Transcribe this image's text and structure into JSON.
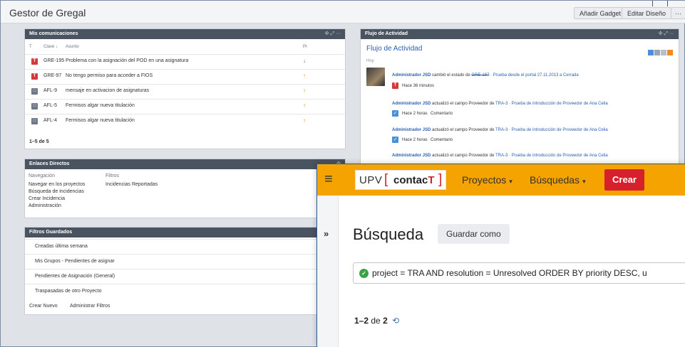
{
  "dashboard": {
    "title": "Gestor de Gregal",
    "add_gadget": "Añadir Gadget",
    "edit_layout": "Editar Diseño",
    "more": "···"
  },
  "comms_gadget": {
    "title": "Mis comunicaciones",
    "controls": "✣ ⤢ ···",
    "col_t": "T",
    "col_key": "Clave ↓",
    "col_summary": "Asunto",
    "col_priority": "Pr",
    "rows": [
      {
        "type": "T",
        "key": "GRE-195",
        "summary": "Problema con la asignación del POD en una asignatura",
        "priority": "↓"
      },
      {
        "type": "T",
        "key": "GRE-97",
        "summary": "No tengo permiso para acceder a FIOS",
        "priority": "↑"
      },
      {
        "type": "□",
        "key": "AFL-9",
        "summary": "mensaje en activacion de asignaturas",
        "priority": "↑"
      },
      {
        "type": "□",
        "key": "AFL-5",
        "summary": "Fermisos algar nueva titulación",
        "priority": "↑"
      },
      {
        "type": "□",
        "key": "AFL-4",
        "summary": "Fermisos algar nueva titulación",
        "priority": "↑"
      }
    ],
    "pager": "1–5 de 5"
  },
  "links_gadget": {
    "title": "Enlaces Directos",
    "controls": "✣",
    "nav_header": "Navegación",
    "filters_header": "Filtros",
    "nav_items": [
      "Navegar en los proyectos",
      "Búsqueda de incidencias",
      "Crear Incidencia",
      "Administración"
    ],
    "filter_items": [
      "Incidencias Reportadas"
    ]
  },
  "saved_filters_gadget": {
    "title": "Filtros Guardados",
    "items": [
      "Creadas última semana",
      "Mis Grupos - Pendientes de asignar",
      "Pendientes de Asignación (General)",
      "Traspasadas de otro Proyecto"
    ],
    "create_new": "Crear Nuevo",
    "manage": "Administrar Filtros"
  },
  "activity_gadget": {
    "header": "Flujo de Actividad",
    "controls": "✣ ⤢ ···",
    "title": "Flujo de Actividad",
    "today": "Hoy",
    "entries": [
      {
        "actor": "Administrador JSD",
        "text": "cambió el estado de",
        "issue": "GRE-187",
        "extra": "· Prueba desde el portal 27.11.2013 a Cerrada",
        "time": "Hace 36 minutos",
        "comment": ""
      },
      {
        "actor": "Administrador JSD",
        "text": "actualizó el campo Proveedor de",
        "issue": "TRA-3",
        "extra": "· Prueba de introducción de Proveedor de Ana Celia",
        "time": "Hace 2 horas",
        "comment": "Comentario"
      },
      {
        "actor": "Administrador JSD",
        "text": "actualizó el campo Proveedor de",
        "issue": "TRA-3",
        "extra": "· Prueba de introducción de Proveedor de Ana Celia",
        "time": "Hace 2 horas",
        "comment": "Comentario"
      },
      {
        "actor": "Administrador JSD",
        "text": "actualizó el campo Proveedor de",
        "issue": "TRA-3",
        "extra": "· Prueba de introducción de Proveedor de Ana Celia",
        "time": "",
        "comment": ""
      }
    ]
  },
  "contact_window": {
    "logo_upv": "UPV",
    "logo_contact_main": "contac",
    "logo_contact_t": "T",
    "nav_projects": "Proyectos",
    "nav_searches": "Búsquedas",
    "create": "Crear",
    "expand": "»",
    "search_title": "Búsqueda",
    "save_as": "Guardar como",
    "jql": "project = TRA AND resolution = Unresolved ORDER BY priority DESC, u",
    "count_range": "1–2",
    "count_of": "de",
    "count_total": "2",
    "refresh": "⟲"
  },
  "colors": {
    "nav_bg": "#f5a300",
    "create_bg": "#d6202c",
    "gadget_header": "#4a5360",
    "link": "#2a5fb0"
  }
}
